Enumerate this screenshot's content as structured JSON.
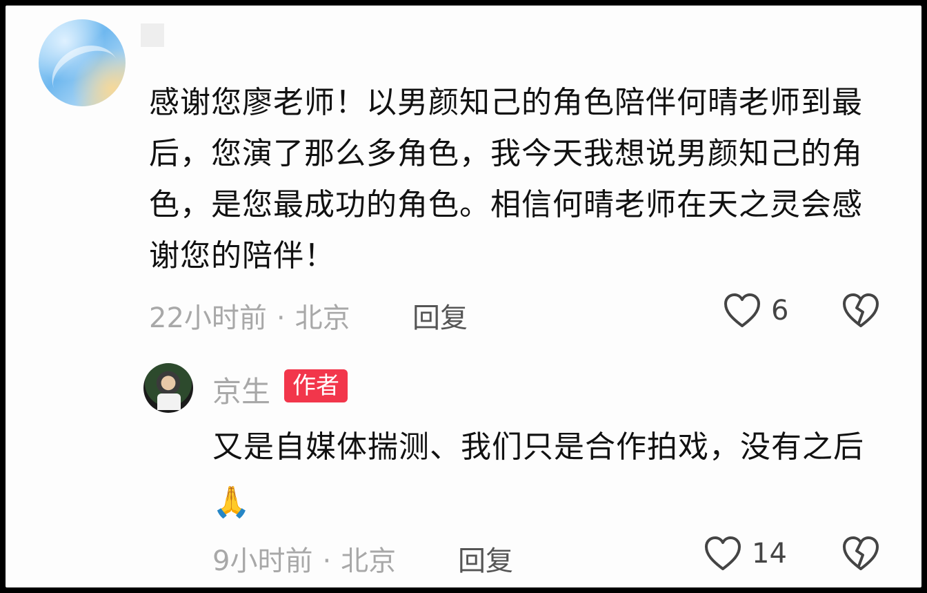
{
  "comment": {
    "text": "感谢您廖老师！以男颜知己的角色陪伴何晴老师到最后，您演了那么多角色，我今天我想说男颜知己的角色，是您最成功的角色。相信何晴老师在天之灵会感谢您的陪伴！",
    "time": "22小时前",
    "location": "北京",
    "separator": "·",
    "reply_label": "回复",
    "like_count": "6"
  },
  "reply": {
    "author": "京生",
    "badge": "作者",
    "text": "又是自媒体揣测、我们只是合作拍戏，没有之后",
    "emoji": "🙏",
    "time": "9小时前",
    "location": "北京",
    "separator": "·",
    "reply_label": "回复",
    "like_count": "14"
  },
  "icons": {
    "like": "heart-outline-icon",
    "dislike": "broken-heart-icon"
  },
  "colors": {
    "badge_bg": "#f2364b",
    "meta_text": "#a8a8a8",
    "body_text": "#111111"
  }
}
